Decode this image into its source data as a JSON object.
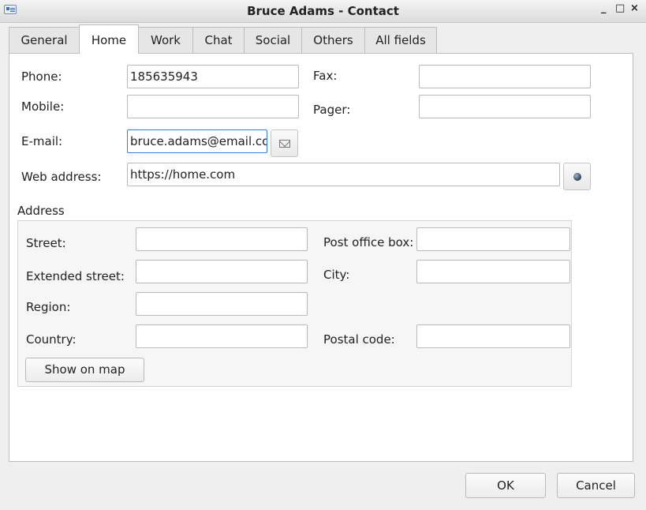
{
  "window": {
    "title": "Bruce Adams - Contact",
    "controls": {
      "minimize": "_",
      "maximize": "□",
      "close": "×"
    }
  },
  "tabs": [
    {
      "label": "General",
      "active": false
    },
    {
      "label": "Home",
      "active": true
    },
    {
      "label": "Work",
      "active": false
    },
    {
      "label": "Chat",
      "active": false
    },
    {
      "label": "Social",
      "active": false
    },
    {
      "label": "Others",
      "active": false
    },
    {
      "label": "All fields",
      "active": false
    }
  ],
  "form": {
    "phone_label": "Phone:",
    "phone_value": "185635943",
    "fax_label": "Fax:",
    "fax_value": "",
    "mobile_label": "Mobile:",
    "mobile_value": "",
    "pager_label": "Pager:",
    "pager_value": "",
    "email_label": "E-mail:",
    "email_value": "bruce.adams@email.com",
    "web_label": "Web address:",
    "web_value": "https://home.com"
  },
  "address": {
    "group_label": "Address",
    "street_label": "Street:",
    "street_value": "",
    "pobox_label": "Post office box:",
    "pobox_value": "",
    "extended_label": "Extended street:",
    "extended_value": "",
    "city_label": "City:",
    "city_value": "",
    "region_label": "Region:",
    "region_value": "",
    "country_label": "Country:",
    "country_value": "",
    "postal_label": "Postal code:",
    "postal_value": "",
    "show_map_label": "Show on map"
  },
  "buttons": {
    "ok": "OK",
    "cancel": "Cancel"
  },
  "icons": {
    "email_button": "envelope-icon",
    "web_button": "globe-icon",
    "app": "contact-card-icon"
  },
  "colors": {
    "focus_border": "#3a7bd5",
    "panel_bg": "#ffffff",
    "window_bg": "#efefef"
  }
}
